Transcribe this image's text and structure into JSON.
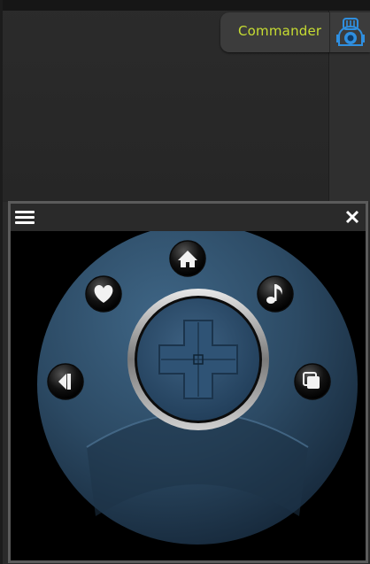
{
  "commander": {
    "label": "Commander",
    "accent_color": "#c7dd32",
    "icon": "robot-icon",
    "icon_color": "#2f8fe0"
  },
  "remote": {
    "menu_icon": "hamburger-menu-icon",
    "close_icon": "close-icon",
    "buttons": [
      {
        "name": "home-button",
        "icon": "home-icon"
      },
      {
        "name": "favorite-button",
        "icon": "heart-icon"
      },
      {
        "name": "music-button",
        "icon": "music-note-icon"
      },
      {
        "name": "back-button",
        "icon": "back-arrow-icon"
      },
      {
        "name": "windows-button",
        "icon": "stacked-windows-icon"
      }
    ],
    "dpad": {
      "name": "directional-pad",
      "center_icon": "ok-button"
    },
    "colors": {
      "body": "#2c4a64",
      "body_dark": "#16283a",
      "ring": "#c9c9c9"
    }
  }
}
